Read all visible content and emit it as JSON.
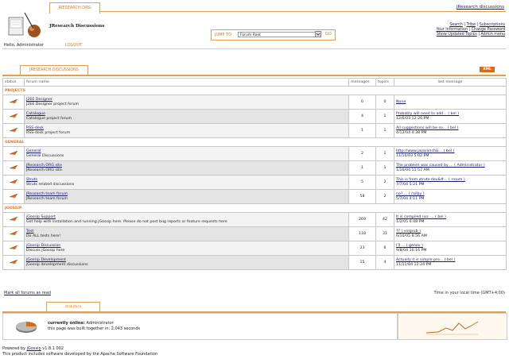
{
  "header": {
    "tab": "JRESEARCH.ORG",
    "top_link": "JResearch discussions",
    "forum_title": "JResearch Discussions",
    "jump_label": "JUMP TO",
    "jump_value": "Forum Root",
    "jump_go": "GO",
    "links": [
      "Search",
      "Tribe",
      "Subscriptions",
      "Your Information",
      "Change Password",
      "Show Updated Topics",
      "Admin menu"
    ],
    "hello": "Hello, Administrator",
    "logout": "LOGOUT"
  },
  "section_tab": "JRESEARCH DISCUSSIONS",
  "xml": "XML",
  "columns": {
    "status": "status",
    "forum": "forum name",
    "messages": "messages",
    "topics": "topics",
    "last": "last message"
  },
  "categories": [
    {
      "name": "PROJECTS",
      "forums": [
        {
          "title": "J2EE Designer",
          "desc": "J2EE Designer project forum",
          "messages": "0",
          "topics": "0",
          "last1": "None",
          "last2": ""
        },
        {
          "title": "Catalogue",
          "desc": "Catalogue project forum",
          "messages": "4",
          "topics": "1",
          "last1": "Probably will need to add... ( bel )",
          "last2": "12/6/03 12:26 PM"
        },
        {
          "title": "RSS-desk",
          "desc": "RSS-desk project forum",
          "messages": "1",
          "topics": "1",
          "last1": "All suggestions will be so... ( bel )",
          "last2": "4/12/04 4:38 PM"
        }
      ]
    },
    {
      "name": "GENERAL",
      "forums": [
        {
          "title": "General",
          "desc": "General Discussions",
          "messages": "2",
          "topics": "1",
          "last1": "http://www.javaranch&... ( bel )",
          "last2": "11/10/03 5:02 PM"
        },
        {
          "title": "JResearch.ORG site",
          "desc": "JResearch.ORG site",
          "messages": "1",
          "topics": "1",
          "last1": "The problem was caused by ... ( Administrator )",
          "last2": "1/16/04 11:57 AM"
        },
        {
          "title": "Struts",
          "desc": "Struts related discussions",
          "messages": "5",
          "topics": "2",
          "last1": "This is from struts-dev&#... ( rroum )",
          "last2": "7/7/04 5:21 PM"
        },
        {
          "title": "JResearch team forum",
          "desc": "JResearch team forum",
          "messages": "58",
          "topics": "2",
          "last1": "no? ... ( railby )",
          "last2": "5/7/04 4:11 PM"
        }
      ]
    },
    {
      "name": "JGOSSIP",
      "forums": [
        {
          "title": "jGossip Support",
          "desc": "Get help with installation and running jGossip here. Please do not post bug reports or feature requests here",
          "messages": "269",
          "topics": "42",
          "last1": "It is compiled (so: ... ( bel )",
          "last2": "1/2/05 6:48 PM"
        },
        {
          "title": "Test",
          "desc": "Do ALL tests here!",
          "messages": "118",
          "topics": "31",
          "last1": "?? ( volgrub )",
          "last2": "6/10/05 8:56 AM"
        },
        {
          "title": "jGossip Discussion",
          "desc": "Discuss jGossip here",
          "messages": "23",
          "topics": "6",
          "last1": "I'll ... ( genov )",
          "last2": "9/8/04 10:16 PM"
        },
        {
          "title": "jGossip Development",
          "desc": "jGossip development discussions",
          "messages": "15",
          "topics": "4",
          "last1": "Actually it is simple pro... ( bel )",
          "last2": "11/11/04 12:24 PM"
        }
      ]
    }
  ],
  "footer": {
    "mark_read": "Mark all forums as read",
    "timezone": "Time in your local time (GMT+4:00)",
    "stat_tab": "statistics",
    "online_label": "currently online:",
    "online_value": "Administrator",
    "build_label": "this page was built together in:",
    "build_value": "2,043 seconds",
    "powered_prefix": "Powered by",
    "powered_link": "jGossip",
    "powered_version": "v1.8.1 002",
    "license": "This product includes software developed by the Apache Software Foundation"
  }
}
